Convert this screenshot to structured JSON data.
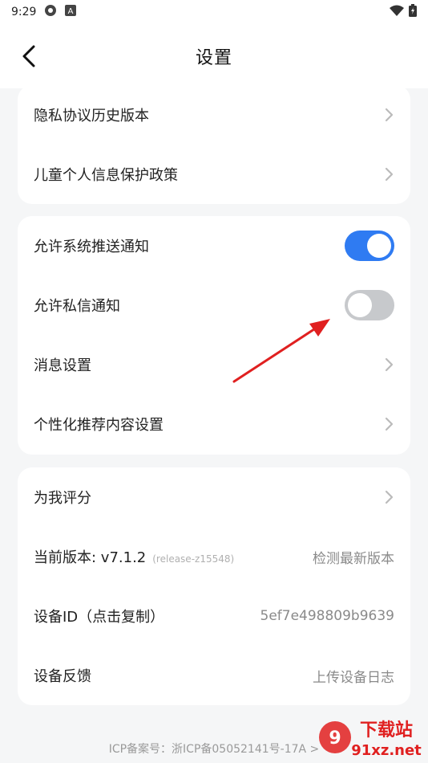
{
  "status_bar": {
    "time": "9:29"
  },
  "header": {
    "title": "设置"
  },
  "card1": {
    "items": [
      {
        "label": "隐私协议历史版本"
      },
      {
        "label": "儿童个人信息保护政策"
      }
    ]
  },
  "card2": {
    "items": [
      {
        "label": "允许系统推送通知",
        "toggle_on": true
      },
      {
        "label": "允许私信通知",
        "toggle_on": false
      },
      {
        "label": "消息设置"
      },
      {
        "label": "个性化推荐内容设置"
      }
    ]
  },
  "card3": {
    "rate": {
      "label": "为我评分"
    },
    "version": {
      "label": "当前版本: v7.1.2",
      "sub": "(release-z15548)",
      "action": "检测最新版本"
    },
    "device_id": {
      "label": "设备ID（点击复制）",
      "value": "5ef7e498809b9639"
    },
    "feedback": {
      "label": "设备反馈",
      "action": "上传设备日志"
    }
  },
  "footer": {
    "icp": "ICP备案号：浙ICP备05052141号-17A >"
  },
  "watermark": {
    "text": "下载站 91xz.net"
  },
  "colors": {
    "accent": "#2f7bf2",
    "annotation": "#e02020"
  }
}
